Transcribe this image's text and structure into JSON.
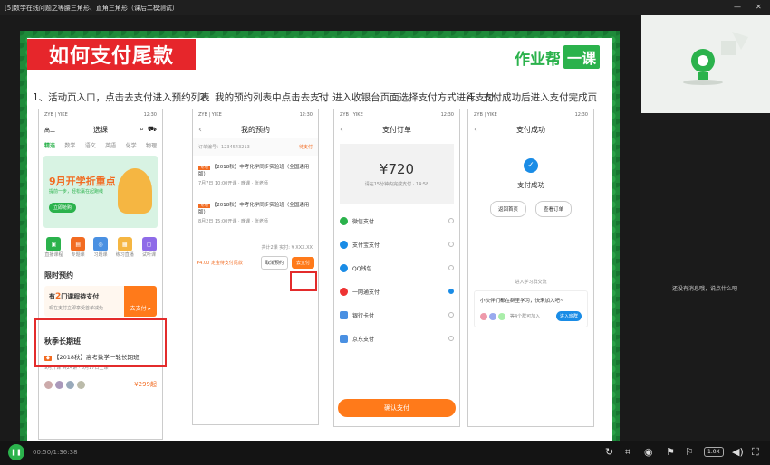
{
  "window": {
    "title": "[5]数学在线问题之等腰三角形、直角三角形（课后二模测试）",
    "minimize": "—",
    "close": "✕"
  },
  "slide": {
    "heading": "如何支付尾款",
    "brand_text": "作业帮",
    "brand_box": "一课",
    "steps": [
      "1、活动页入口，点击去支付进入预约列表",
      "2、我的预约列表中点击去支付",
      "3、进入收银台页面选择支付方式进行支付",
      "4、支付成功后进入支付完成页"
    ],
    "phone1": {
      "status_left": "ZYB | YIKE",
      "status_right": "12:30",
      "grade": "高二",
      "title": "选课",
      "tabs": [
        "精选",
        "数学",
        "语文",
        "英语",
        "化学",
        "物理"
      ],
      "banner_title": "9月开学折重点",
      "banner_sub": "提前一步，轻松赢在起跑线",
      "banner_btn": "立即抢购",
      "icons": [
        "直播课程",
        "专题课",
        "习题课",
        "练习直播",
        "试听课"
      ],
      "section1": "限时预约",
      "promo_prefix": "有",
      "promo_num": "2",
      "promo_suffix": "门课程待支付",
      "promo_sub": "现在支付立即享受首单减免",
      "promo_btn": "去支付 ▸",
      "section2": "秋季长期班",
      "course": "【2018秋】高考数学一轮长期班",
      "course_sub": "9月开课 共24讲 · 5月17日上课",
      "price": "¥299起"
    },
    "phone2": {
      "status_left": "ZYB | YIKE",
      "status_right": "12:30",
      "title": "我的预约",
      "order_no": "订单编号：1234543213",
      "status": "待支付",
      "items": [
        {
          "tag": "专项",
          "name": "【2018秋】中考化学同步实验班（全国通用版）",
          "info": "7月7日 10:00开课 · 晚课 · 张老师"
        },
        {
          "tag": "专项",
          "name": "【2018秋】中考化学同步实验班（全国通用版）",
          "info": "8月2日 15:00开课 · 晚课 · 张老师"
        }
      ],
      "total": "共计2课  实付: ¥ XXX.XX",
      "deposit": "¥4.00 定金待支付尾款",
      "cancel": "取消预约",
      "pay": "去支付"
    },
    "phone3": {
      "status_left": "ZYB | YIKE",
      "status_right": "12:30",
      "title": "支付订单",
      "amount": "¥720",
      "amount_sub": "请在15分钟内完成支付 · 14:58",
      "methods": [
        "微信支付",
        "支付宝支付",
        "QQ钱包",
        "一网通支付",
        "银行卡付",
        "京东支付"
      ],
      "confirm": "确认支付"
    },
    "phone4": {
      "status_left": "ZYB | YIKE",
      "status_right": "12:30",
      "title": "支付成功",
      "success": "支付成功",
      "btn_home": "返回首页",
      "btn_order": "查看订单",
      "group_hint": "进入学习群交流",
      "group_title": "小伙伴们都在群里学习，快来加入吧~",
      "group_count": "等4个群可加入",
      "join": "进入班群"
    }
  },
  "side": {
    "message": "还没有消息哦，说点什么吧"
  },
  "player": {
    "time": "00:50/1:36:38",
    "speed": "1.0X"
  }
}
